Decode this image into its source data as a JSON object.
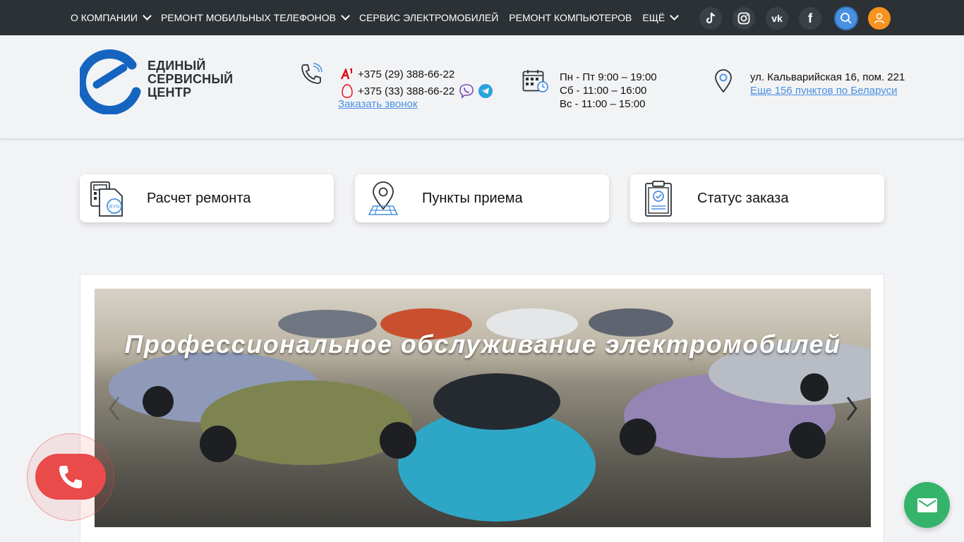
{
  "nav": {
    "items": [
      {
        "label": "О КОМПАНИИ",
        "has_dropdown": true
      },
      {
        "label": "РЕМОНТ МОБИЛЬНЫХ ТЕЛЕФОНОВ",
        "has_dropdown": true
      },
      {
        "label": "СЕРВИС ЭЛЕКТРОМОБИЛЕЙ",
        "has_dropdown": false
      },
      {
        "label": "РЕМОНТ КОМПЬЮТЕРОВ",
        "has_dropdown": false
      },
      {
        "label": "ЕЩЁ",
        "has_dropdown": true
      }
    ],
    "social": [
      "tiktok-icon",
      "instagram-icon",
      "vk-icon",
      "facebook-icon"
    ],
    "social_text": {
      "vk": "vk",
      "facebook": "f"
    }
  },
  "logo": {
    "line1": "ЕДИНЫЙ",
    "line2": "СЕРВИСНЫЙ",
    "line3": "ЦЕНТР",
    "color": "#1565c0"
  },
  "contacts": {
    "phones": [
      {
        "operator": "A1",
        "number": "+375 (29) 388-66-22"
      },
      {
        "operator": "MTS",
        "number": "+375 (33) 388-66-22"
      }
    ],
    "callback": "Заказать звонок",
    "hours": [
      "Пн - Пт 9:00 – 19:00",
      "Сб - 11:00 – 16:00",
      "Вс - 11:00 – 15:00"
    ],
    "address": "ул. Кальварийская 16, пом. 221",
    "more_points": "Еще 156 пунктов по Беларуси"
  },
  "cards": [
    {
      "label": "Расчет ремонта",
      "icon": "calculator-icon"
    },
    {
      "label": "Пункты приема",
      "icon": "map-pin-icon"
    },
    {
      "label": "Статус заказа",
      "icon": "clipboard-check-icon"
    }
  ],
  "slider": {
    "title": "Профессиональное обслуживание электромобилей"
  },
  "colors": {
    "topbar": "#2b3135",
    "accent_blue": "#4a90e2",
    "user_orange": "#f7931e",
    "call_red": "#e94a4a",
    "mail_green": "#34b46a"
  }
}
